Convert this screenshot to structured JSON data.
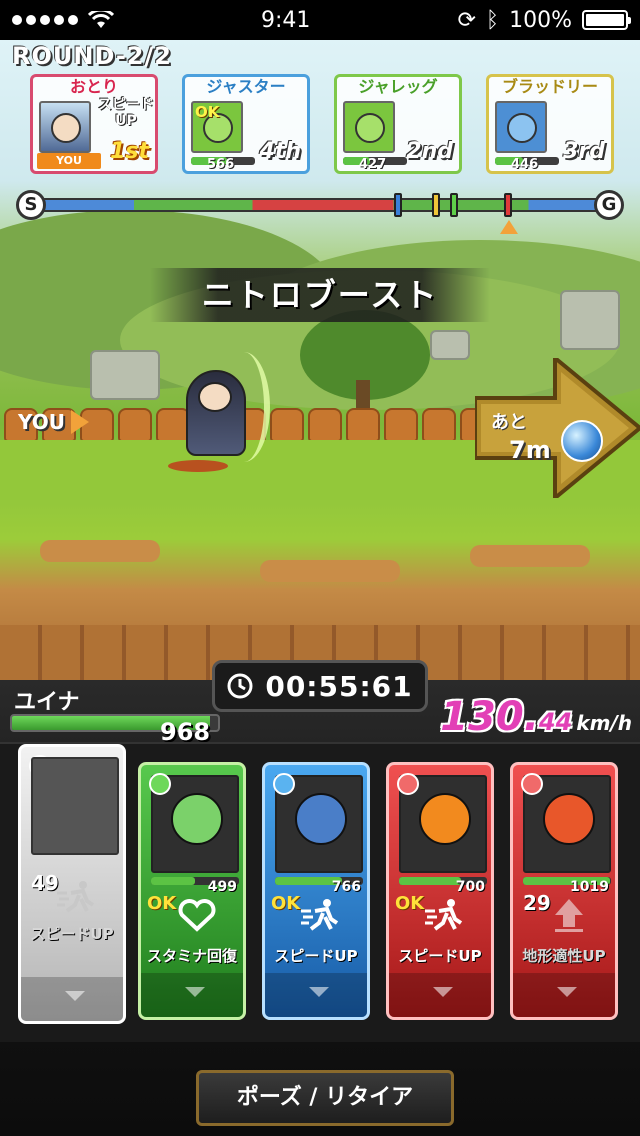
{
  "status_bar": {
    "time": "9:41",
    "battery": "100%"
  },
  "race": {
    "round": "ROUND-2/2",
    "boost_banner": "ニトロブースト",
    "you_marker": "YOU",
    "distance_label": "あと",
    "distance_value": "7m"
  },
  "racers": [
    {
      "name": "おとり",
      "skill": "スピードUP",
      "you_label": "YOU",
      "rank": "1st",
      "color": "#d84b6f"
    },
    {
      "name": "ジャスター",
      "ok": "OK",
      "hp": "566",
      "hp_fraction": 0.56,
      "rank": "4th",
      "color": "#4ba0dd"
    },
    {
      "name": "ジャレッグ",
      "hp": "427",
      "hp_fraction": 0.42,
      "rank": "2nd",
      "color": "#7ec84a"
    },
    {
      "name": "ブラッドリー",
      "hp": "446",
      "hp_fraction": 0.44,
      "rank": "3rd",
      "color": "#d6c34b"
    }
  ],
  "progress": {
    "start_label": "S",
    "goal_label": "G",
    "marker_colors": [
      "#3a7fd8",
      "#f0c63a",
      "#5fd04a",
      "#e03a3a"
    ]
  },
  "hud": {
    "timer": "00:55:61",
    "player_name": "ユイナ",
    "player_hp": "968",
    "player_hp_fraction": 0.96,
    "speed_main": "130.",
    "speed_decimal": "44",
    "speed_unit": "km/h",
    "pause_label": "ポーズ / リタイア"
  },
  "cards": [
    {
      "state": "selected",
      "cooldown": "49",
      "skill": "スピードUP",
      "orb": "#9a9a9a"
    },
    {
      "state": "green",
      "hp": "499",
      "hp_fraction": 0.5,
      "ok": "OK",
      "skill": "スタミナ回復",
      "orb": "#6ed85a",
      "figure": "#7bd16a"
    },
    {
      "state": "blue",
      "hp": "766",
      "hp_fraction": 0.76,
      "ok": "OK",
      "skill": "スピードUP",
      "orb": "#5ab3f0",
      "figure": "#4a7ec8"
    },
    {
      "state": "red",
      "hp": "700",
      "hp_fraction": 0.7,
      "ok": "OK",
      "skill": "スピードUP",
      "orb": "#f06a6a",
      "figure": "#f28a1e"
    },
    {
      "state": "red",
      "hp": "1019",
      "hp_fraction": 0.99,
      "cooldown": "29",
      "skill": "地形適性UP",
      "orb": "#f06a6a",
      "figure": "#e8572a"
    }
  ]
}
